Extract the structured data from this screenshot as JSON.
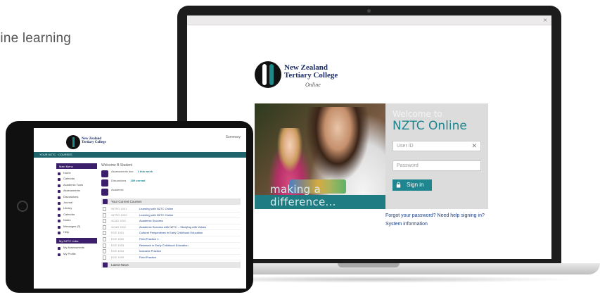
{
  "headline": "line learning",
  "laptop": {
    "browser_btn": "✕",
    "logo": {
      "line1": "New Zealand",
      "line2": "Tertiary College",
      "online": "Online"
    },
    "hero_caption": "making a difference...",
    "login": {
      "welcome": "Welcome to",
      "title": "NZTC Online",
      "userid_placeholder": "User ID",
      "password_placeholder": "Password",
      "clear": "✕",
      "signin_label": "Sign in"
    },
    "forgot_link": "Forgot your password?   Need help signing in?",
    "sysinfo_link": "System information"
  },
  "tablet": {
    "logo": {
      "line1": "New Zealand",
      "line2": "Tertiary College"
    },
    "toplink": "Summary",
    "nav_text": "YOUR NZTC  ·  COURSES",
    "sidebar_head": "Main Menu",
    "sidebar": [
      "Home",
      "Calendar",
      "Academic Tools",
      "Assessments",
      "Discussions",
      "Journal",
      "Library",
      "Calendar",
      "Notes",
      "Messages (0)",
      "Help"
    ],
    "sidebar_head2": "My NZTC Links",
    "sidebar2": [
      "My Assessments",
      "My Profile"
    ],
    "welcome": "Welcome B Student",
    "stats": [
      {
        "label": "Assessments due",
        "value": "1 this week"
      },
      {
        "label": "Discussions",
        "value": "189 unread"
      },
      {
        "label": "Academic",
        "value": ""
      }
    ],
    "courses_head": "Your Current Courses",
    "courses": [
      {
        "code": "INTRO 1001",
        "name": "Learning with NZTC Online"
      },
      {
        "code": "INTRO 1002",
        "name": "Learning with NZTC Online"
      },
      {
        "code": "ACAD 1001",
        "name": "Academic Success"
      },
      {
        "code": "ACAD 1002",
        "name": "Academic Success with NZTC – Studying with Values"
      },
      {
        "code": "ECE 1001",
        "name": "Cultural Perspectives in Early Childhood Education"
      },
      {
        "code": "ECE 1002",
        "name": "Field Practice 1"
      },
      {
        "code": "ECE 1003",
        "name": "Research in Early Childhood Education"
      },
      {
        "code": "ECE 1004",
        "name": "Inclusive Practice"
      },
      {
        "code": "ECE 1005",
        "name": "Field Practice"
      }
    ],
    "latest_head": "Latest News"
  }
}
